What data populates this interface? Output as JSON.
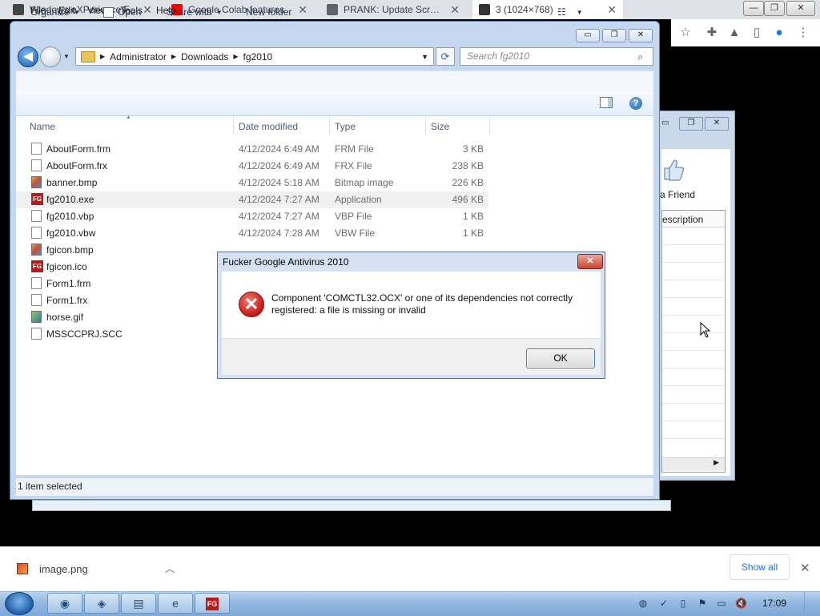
{
  "chrome": {
    "tabs": [
      {
        "label": "Windows eXPerience F",
        "active": false,
        "favicon": "building-icon"
      },
      {
        "label": "Google Colab features",
        "active": false,
        "favicon": "youtube-icon"
      },
      {
        "label": "PRANK: Update Screen",
        "active": false,
        "favicon": "globe-icon"
      },
      {
        "label": "3 (1024×768)",
        "active": true,
        "favicon": "image-icon"
      }
    ],
    "tab_close": "✕",
    "window_controls": {
      "minimize": "—",
      "restore": "❐",
      "close": "✕"
    },
    "toolbar_icons": [
      "star-icon",
      "extensions-icon",
      "labs-icon",
      "side-panel-icon",
      "profile-icon",
      "menu-icon"
    ]
  },
  "explorer": {
    "breadcrumb": [
      "Administrator",
      "Downloads",
      "fg2010"
    ],
    "search_placeholder": "Search fg2010",
    "menu": [
      "File",
      "Edit",
      "View",
      "Tools",
      "Help"
    ],
    "commands": {
      "organize": "Organize",
      "open": "Open",
      "share_with": "Share with",
      "new_folder": "New folder"
    },
    "columns": {
      "name": "Name",
      "date": "Date modified",
      "type": "Type",
      "size": "Size"
    },
    "files": [
      {
        "name": "AboutForm.frm",
        "date": "4/12/2024 6:49 AM",
        "type": "FRM File",
        "size": "3 KB",
        "icon": "doc"
      },
      {
        "name": "AboutForm.frx",
        "date": "4/12/2024 6:49 AM",
        "type": "FRX File",
        "size": "238 KB",
        "icon": "doc"
      },
      {
        "name": "banner.bmp",
        "date": "4/12/2024 5:18 AM",
        "type": "Bitmap image",
        "size": "226 KB",
        "icon": "img"
      },
      {
        "name": "fg2010.exe",
        "date": "4/12/2024 7:27 AM",
        "type": "Application",
        "size": "496 KB",
        "icon": "fg",
        "selected": true
      },
      {
        "name": "fg2010.vbp",
        "date": "4/12/2024 7:27 AM",
        "type": "VBP File",
        "size": "1 KB",
        "icon": "doc"
      },
      {
        "name": "fg2010.vbw",
        "date": "4/12/2024 7:28 AM",
        "type": "VBW File",
        "size": "1 KB",
        "icon": "doc"
      },
      {
        "name": "fgicon.bmp",
        "date": "",
        "type": "",
        "size": "",
        "icon": "img"
      },
      {
        "name": "fgicon.ico",
        "date": "",
        "type": "",
        "size": "",
        "icon": "fg"
      },
      {
        "name": "Form1.frm",
        "date": "",
        "type": "",
        "size": "",
        "icon": "doc"
      },
      {
        "name": "Form1.frx",
        "date": "",
        "type": "",
        "size": "",
        "icon": "doc"
      },
      {
        "name": "horse.gif",
        "date": "",
        "type": "",
        "size": "",
        "icon": "gif"
      },
      {
        "name": "MSSCCPRJ.SCC",
        "date": "",
        "type": "",
        "size": "",
        "icon": "doc"
      }
    ],
    "status": "1 item selected"
  },
  "background_window": {
    "friend_label": "a Friend",
    "column_label": "escription"
  },
  "dialog": {
    "title": "Fucker Google Antivirus 2010",
    "message_line1": "Component 'COMCTL32.OCX' or one of its dependencies not correctly",
    "message_line2": "registered: a file is missing or invalid",
    "ok_label": "OK",
    "close_glyph": "✕"
  },
  "download_shelf": {
    "filename": "image.png",
    "show_all": "Show all",
    "close_glyph": "✕"
  },
  "taskbar": {
    "fg_label": "FG",
    "clock": "17:09"
  }
}
